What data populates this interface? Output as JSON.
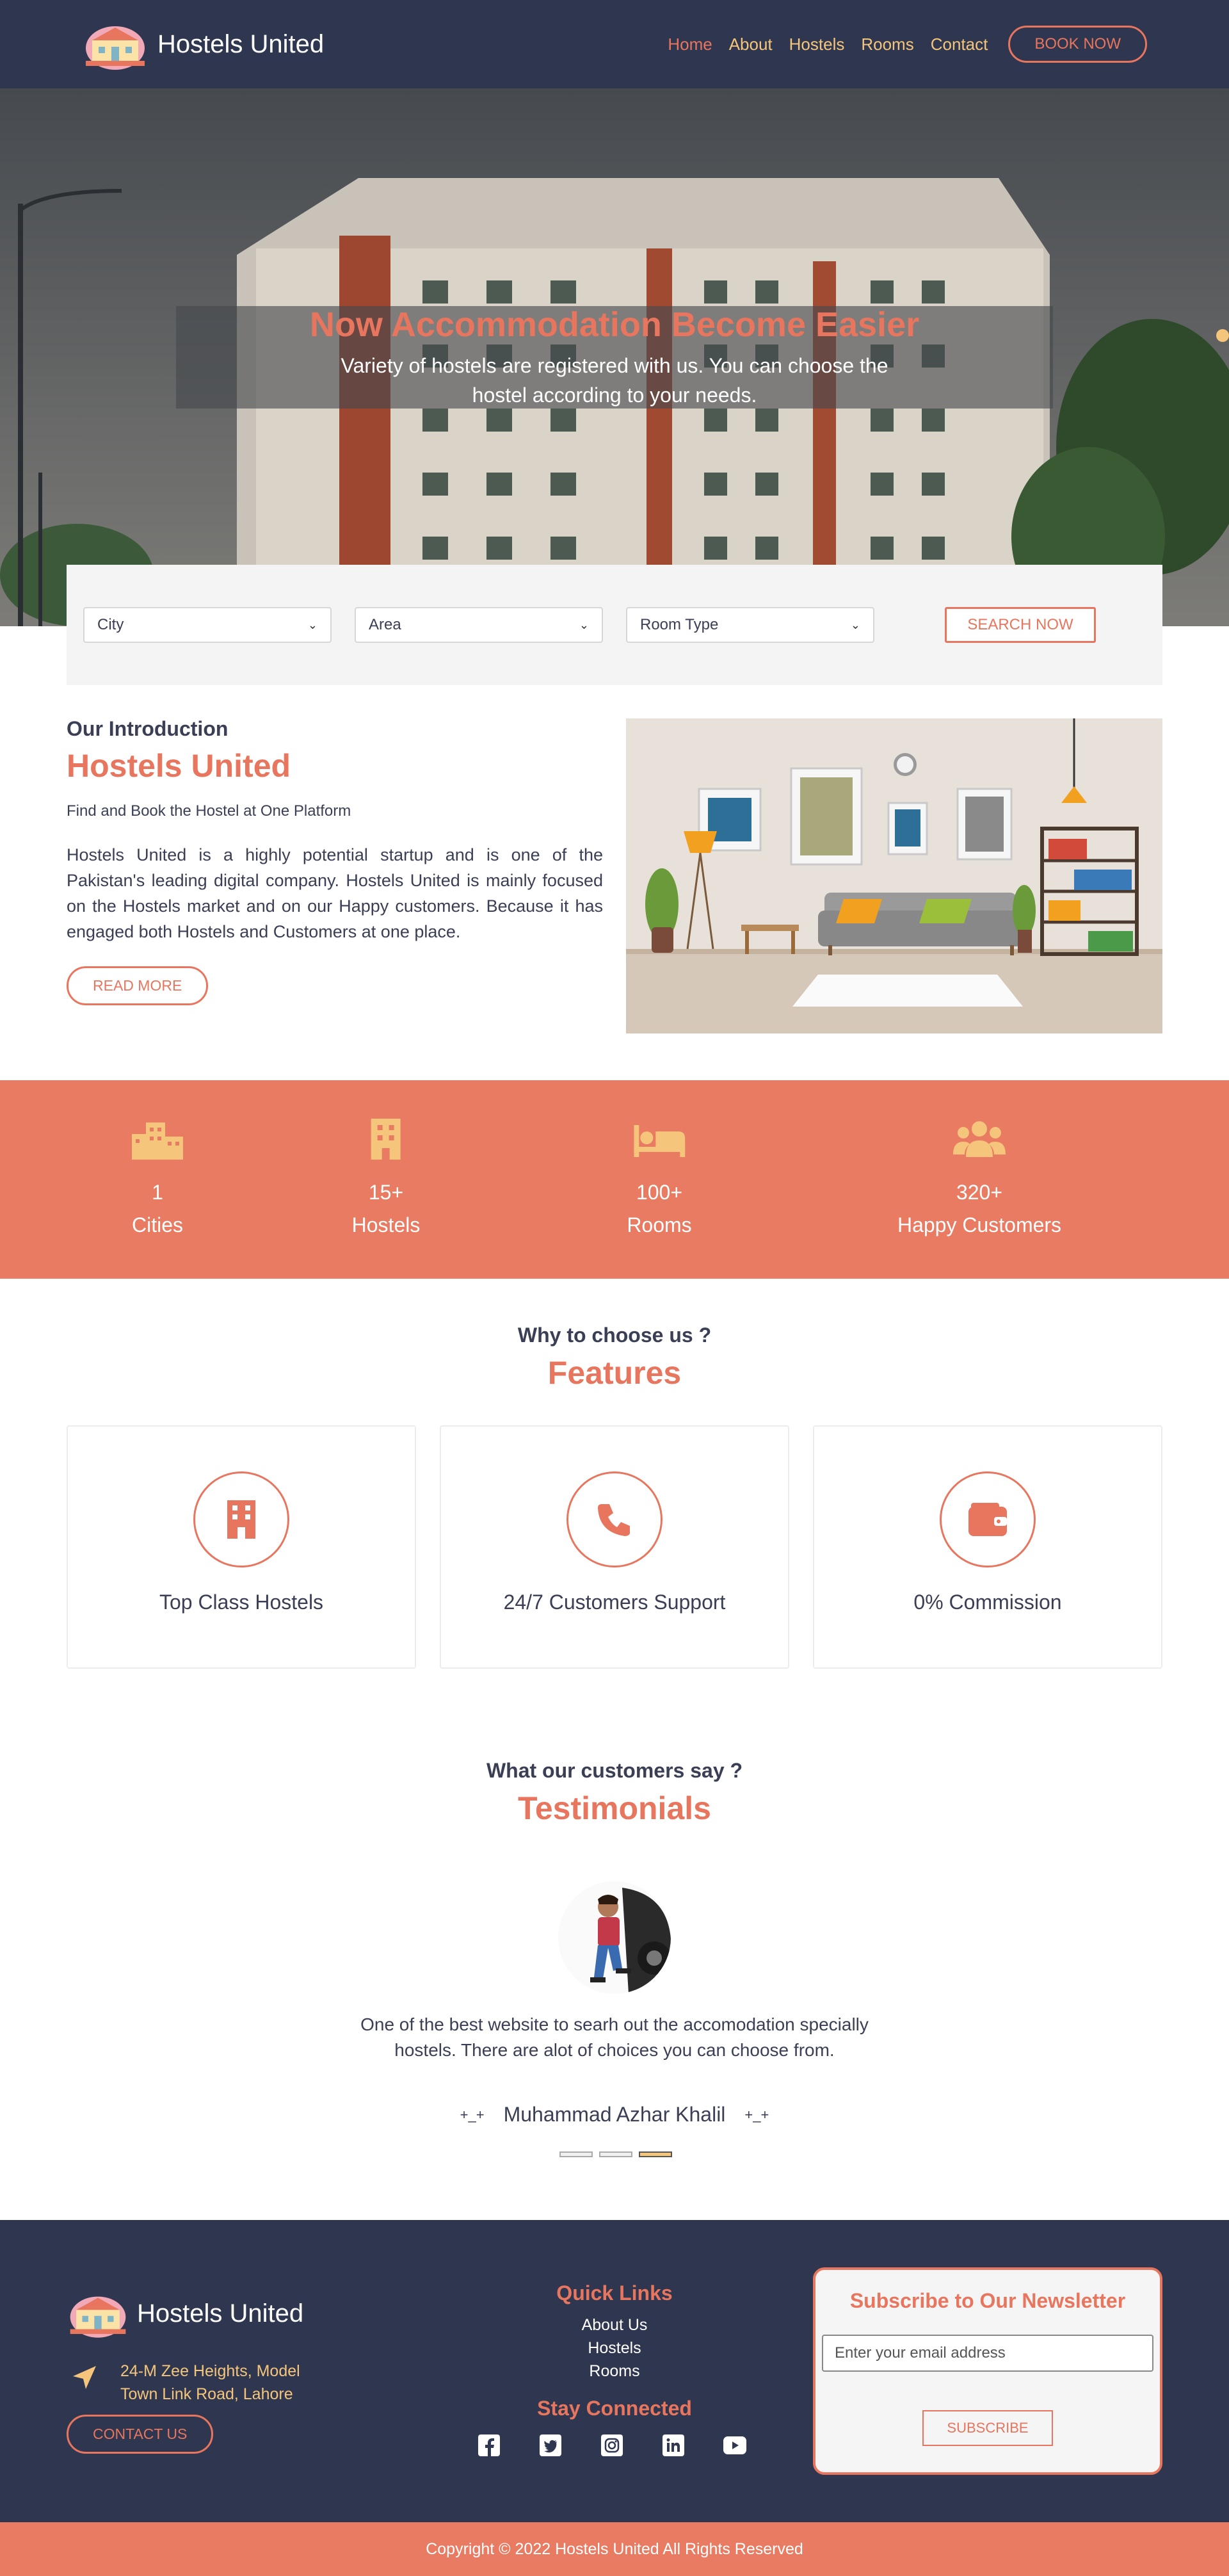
{
  "nav": {
    "brand": "Hostels United",
    "links": [
      {
        "label": "Home",
        "active": true
      },
      {
        "label": "About"
      },
      {
        "label": "Hostels"
      },
      {
        "label": "Rooms"
      },
      {
        "label": "Contact"
      }
    ],
    "cta": "BOOK NOW"
  },
  "hero": {
    "title": "Now Accommodation Become Easier",
    "subtitle": "Variety of hostels are registered with us. You can choose the hostel according to your needs."
  },
  "search": {
    "city": "City",
    "area": "Area",
    "room_type": "Room Type",
    "button": "SEARCH NOW"
  },
  "intro": {
    "kicker": "Our Introduction",
    "title": "Hostels United",
    "tagline": "Find and Book the Hostel at One Platform",
    "body": "Hostels United is a highly potential startup and is one of the Pakistan's leading digital company. Hostels United is mainly focused on the Hostels market and on our Happy customers. Because it has engaged both Hostels and Customers at one place.",
    "button": "READ MORE"
  },
  "stats": [
    {
      "icon": "city-icon",
      "value": "1",
      "label": "Cities"
    },
    {
      "icon": "building-icon",
      "value": "15+",
      "label": "Hostels"
    },
    {
      "icon": "bed-icon",
      "value": "100+",
      "label": "Rooms"
    },
    {
      "icon": "users-icon",
      "value": "320+",
      "label": "Happy Customers"
    }
  ],
  "features": {
    "kicker": "Why to choose us ?",
    "title": "Features",
    "items": [
      {
        "icon": "building-icon",
        "label": "Top Class Hostels"
      },
      {
        "icon": "phone-icon",
        "label": "24/7 Customers Support"
      },
      {
        "icon": "wallet-icon",
        "label": "0% Commission"
      }
    ]
  },
  "testimonials": {
    "kicker": "What our customers say ?",
    "title": "Testimonials",
    "quote": "One of the best website to searh out the accomodation specially hostels. There are alot of choices you can choose from.",
    "name": "Muhammad Azhar Khalil",
    "decor_left": "+_+",
    "decor_right": "+_+",
    "active_slide": 3,
    "slide_count": 3
  },
  "footer": {
    "brand": "Hostels United",
    "address": "24-M Zee Heights, Model Town Link Road, Lahore",
    "contact_button": "CONTACT US",
    "quick_links_title": "Quick Links",
    "quick_links": [
      "About Us",
      "Hostels",
      "Rooms"
    ],
    "stay_connected": "Stay Connected",
    "socials": [
      "facebook-icon",
      "twitter-icon",
      "instagram-icon",
      "linkedin-icon",
      "youtube-icon"
    ],
    "newsletter_title": "Subscribe to Our Newsletter",
    "newsletter_placeholder": "Enter your email address",
    "newsletter_button": "SUBSCRIBE"
  },
  "copyright": "Copyright © 2022 Hostels United All Rights Reserved",
  "colors": {
    "navy": "#2e3650",
    "coral": "#e8765e",
    "gold": "#f4c57a"
  }
}
